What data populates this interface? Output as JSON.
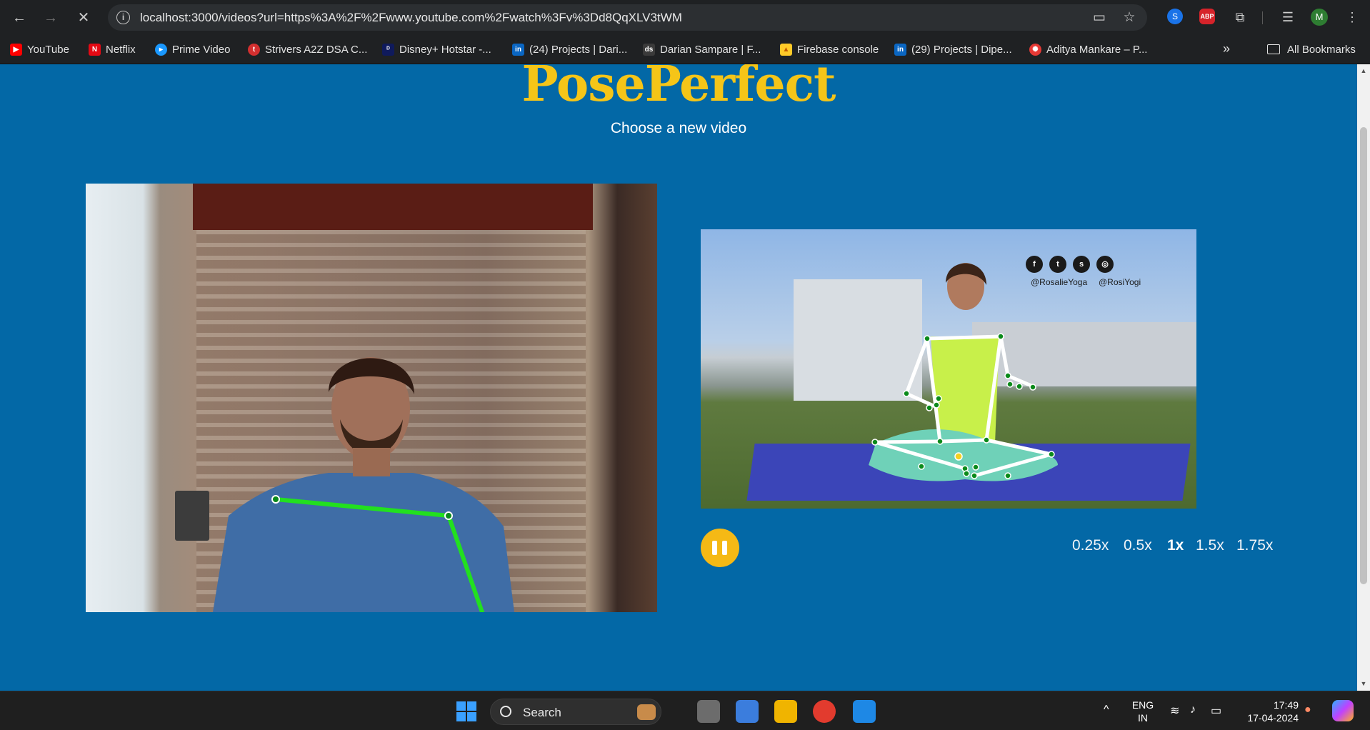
{
  "browser": {
    "url": "localhost:3000/videos?url=https%3A%2F%2Fwww.youtube.com%2Fwatch%3Fv%3Dd8QqXLV3tWM",
    "profile_initial": "M",
    "ext_abp_label": "ABP"
  },
  "bookmarks": {
    "items": [
      {
        "label": "YouTube",
        "color": "#ff0000"
      },
      {
        "label": "Netflix",
        "color": "#e50914"
      },
      {
        "label": "Prime Video",
        "color": "#1a98ff"
      },
      {
        "label": "Strivers A2Z DSA C...",
        "color": "#d32f2f"
      },
      {
        "label": "Disney+ Hotstar -...",
        "color": "#0f1a5c"
      },
      {
        "label": "(24) Projects | Dari...",
        "color": "#0a66c2"
      },
      {
        "label": "Darian Sampare | F...",
        "color": "#3a3a3a"
      },
      {
        "label": "Firebase console",
        "color": "#ffca28"
      },
      {
        "label": "(29) Projects | Dipe...",
        "color": "#0a66c2"
      },
      {
        "label": "Aditya Mankare – P...",
        "color": "#e53935"
      }
    ],
    "all_bookmarks": "All Bookmarks"
  },
  "page": {
    "brand": "PosePerfect",
    "subtitle": "Choose a new video",
    "social_handle_1": "@RosalieYoga",
    "social_handle_2": "@RosiYogi",
    "speeds": [
      "0.25x",
      "0.5x",
      "1x",
      "1.5x",
      "1.75x"
    ],
    "active_speed": "1x"
  },
  "taskbar": {
    "search_label": "Search",
    "lang_1": "ENG",
    "lang_2": "IN",
    "time": "17:49",
    "date": "17-04-2024"
  },
  "colors": {
    "page_bg": "#0368a6",
    "brand": "#f5c518",
    "pose_line_user": "#22e01f",
    "pose_line_video": "#ffffff",
    "joint": "#0a8a1a",
    "play_button": "#f5b915"
  }
}
